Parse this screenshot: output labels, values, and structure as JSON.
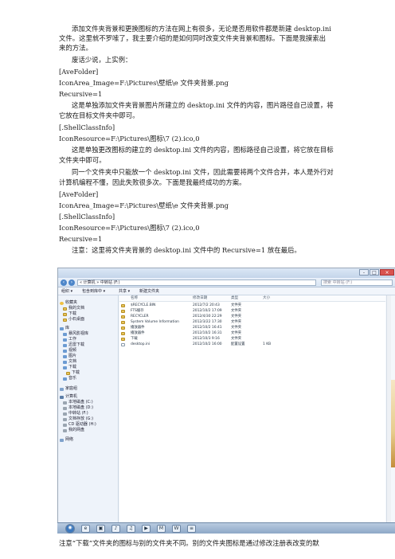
{
  "paragraphs": {
    "p1a": "添加文件夹背景和更换图标的方法在网上有很多，无论是否用软件都是新建 desktop.ini",
    "p1b": "文件。这里就不罗嗦了，我主要介绍的是如何同时改变文件夹背景和图标。下面是我摸索出",
    "p1c": "来的方法。",
    "p2": "废话少说，上实例：",
    "code1a": "[AveFolder]",
    "code1b": "IconArea_Image=F:\\Pictures\\壁纸\\e 文件夹背景.png",
    "code1c": "Recursive=1",
    "p3a": "这是单独添加文件夹背景图片所建立的 desktop.ini 文件的内容，图片路径自己设置，将",
    "p3b": "它放在目标文件夹中即可。",
    "code2a": "[.ShellClassInfo]",
    "code2b": "IconResource=F:\\Pictures\\图标\\7 (2).ico,0",
    "p4a": "这是单独更改图标的建立的 desktop.ini 文件的内容，图标路径自己设置，将它放在目标",
    "p4b": "文件夹中即可。",
    "p5a": "同一个文件夹中只能放一个 desktop.ini 文件，因此需要将两个文件合并，本人是外行对",
    "p5b": "计算机编程不懂，因此失败很多次。下面是我最终成功的方案。",
    "code3a": "[AveFolder]",
    "code3b": "IconArea_Image=F:\\Pictures\\壁纸\\e 文件夹背景.png",
    "code3c": "[.ShellClassInfo]",
    "code3d": "IconResource=F:\\Pictures\\图标\\7 (2).ico,0",
    "code3e": "Recursive=1",
    "p6": "注意：这里将文件夹背景的 desktop.ini 文件中的 Recursive=1 放在最后。",
    "p7": "注意“下载”文件夹的图标与别的文件夹不同。别的文件夹图标是通过修改注册表改变的默"
  },
  "explorer": {
    "window_buttons": [
      "-",
      "□",
      "×"
    ],
    "address": "« 计算机 » 中转站 (F:)",
    "search_placeholder": "搜索 中转站 (F:)",
    "toolbar": [
      "组织 ▾",
      "包含到库中 ▾",
      "共享 ▾",
      "新建文件夹"
    ],
    "sidebar": [
      {
        "label": "收藏夹",
        "icon": "star"
      },
      {
        "label": "我的文档",
        "icon": "folder"
      },
      {
        "label": "下载",
        "icon": "folder"
      },
      {
        "label": "小石桌面",
        "icon": "folder"
      },
      {
        "label": "库",
        "icon": "lib"
      },
      {
        "label": "暴风影视库",
        "icon": "lib"
      },
      {
        "label": "工作",
        "icon": "lib"
      },
      {
        "label": "迅雷下载",
        "icon": "lib"
      },
      {
        "label": "视频",
        "icon": "lib"
      },
      {
        "label": "图片",
        "icon": "lib"
      },
      {
        "label": "文档",
        "icon": "lib"
      },
      {
        "label": "下载",
        "icon": "lib"
      },
      {
        "label": "下载",
        "icon": "folder"
      },
      {
        "label": "音乐",
        "icon": "lib"
      },
      {
        "label": "家庭组",
        "icon": "net"
      },
      {
        "label": "计算机",
        "icon": "pc"
      },
      {
        "label": "本地磁盘 (C:)",
        "icon": "drive"
      },
      {
        "label": "本地磁盘 (D:)",
        "icon": "drive"
      },
      {
        "label": "中转站 (F:)",
        "icon": "drive"
      },
      {
        "label": "文档存放 (G:)",
        "icon": "drive"
      },
      {
        "label": "CD 驱动器 (H:)",
        "icon": "drive"
      },
      {
        "label": "我的网盘",
        "icon": "drive"
      },
      {
        "label": "网络",
        "icon": "net"
      }
    ],
    "columns": [
      "名称",
      "修改日期",
      "类型",
      "大小"
    ],
    "files": [
      {
        "name": "$RECYCLE.BIN",
        "date": "2012/7/2 20:43",
        "type": "文件夹",
        "size": "",
        "icon": "folder"
      },
      {
        "name": "FTS缓存",
        "date": "2012/10/2 17:09",
        "type": "文件夹",
        "size": "",
        "icon": "folder"
      },
      {
        "name": "RECYCLER",
        "date": "2012/4/30 22:29",
        "type": "文件夹",
        "size": "",
        "icon": "folder"
      },
      {
        "name": "System Volume Information",
        "date": "2012/3/22 17:30",
        "type": "文件夹",
        "size": "",
        "icon": "folder"
      },
      {
        "name": "播放器件",
        "date": "2012/10/2 16:41",
        "type": "文件夹",
        "size": "",
        "icon": "folder"
      },
      {
        "name": "播放器件",
        "date": "2012/10/2 16:31",
        "type": "文件夹",
        "size": "",
        "icon": "folder"
      },
      {
        "name": "下载",
        "date": "2012/10/3 9:16",
        "type": "文件夹",
        "size": "",
        "icon": "folder"
      },
      {
        "name": "desktop.ini",
        "date": "2012/10/2 16:00",
        "type": "配置设置",
        "size": "1 KB",
        "icon": "file"
      }
    ],
    "taskbar": [
      "◉",
      "e",
      "▣",
      "♪",
      "♫",
      "▶",
      "M",
      "W",
      "≡"
    ]
  }
}
